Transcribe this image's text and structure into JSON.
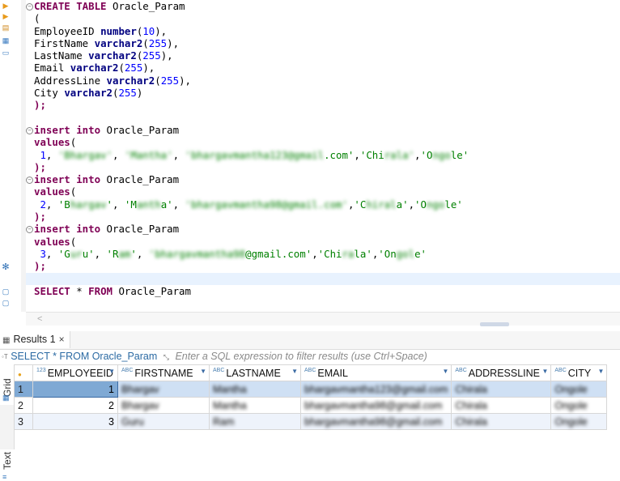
{
  "editor": {
    "lines": [
      {
        "segs": [
          {
            "t": "CREATE TABLE",
            "c": "kw"
          },
          {
            "t": " Oracle_Param",
            "c": ""
          }
        ],
        "fold": true
      },
      {
        "segs": [
          {
            "t": "(",
            "c": ""
          }
        ]
      },
      {
        "segs": [
          {
            "t": "EmployeeID ",
            "c": ""
          },
          {
            "t": "number",
            "c": "ty"
          },
          {
            "t": "(",
            "c": ""
          },
          {
            "t": "10",
            "c": "num"
          },
          {
            "t": "),",
            "c": ""
          }
        ]
      },
      {
        "segs": [
          {
            "t": "FirstName ",
            "c": ""
          },
          {
            "t": "varchar2",
            "c": "ty"
          },
          {
            "t": "(",
            "c": ""
          },
          {
            "t": "255",
            "c": "num"
          },
          {
            "t": "),",
            "c": ""
          }
        ]
      },
      {
        "segs": [
          {
            "t": "LastName ",
            "c": ""
          },
          {
            "t": "varchar2",
            "c": "ty"
          },
          {
            "t": "(",
            "c": ""
          },
          {
            "t": "255",
            "c": "num"
          },
          {
            "t": "),",
            "c": ""
          }
        ]
      },
      {
        "segs": [
          {
            "t": "Email ",
            "c": ""
          },
          {
            "t": "varchar2",
            "c": "ty"
          },
          {
            "t": "(",
            "c": ""
          },
          {
            "t": "255",
            "c": "num"
          },
          {
            "t": "),",
            "c": ""
          }
        ]
      },
      {
        "segs": [
          {
            "t": "AddressLine ",
            "c": ""
          },
          {
            "t": "varchar2",
            "c": "ty"
          },
          {
            "t": "(",
            "c": ""
          },
          {
            "t": "255",
            "c": "num"
          },
          {
            "t": "),",
            "c": ""
          }
        ]
      },
      {
        "segs": [
          {
            "t": "City ",
            "c": ""
          },
          {
            "t": "varchar2",
            "c": "ty"
          },
          {
            "t": "(",
            "c": ""
          },
          {
            "t": "255",
            "c": "num"
          },
          {
            "t": ")",
            "c": ""
          }
        ]
      },
      {
        "segs": [
          {
            "t": ");",
            "c": "kw"
          }
        ]
      },
      {
        "segs": []
      },
      {
        "segs": [
          {
            "t": "insert into",
            "c": "kw"
          },
          {
            "t": " Oracle_Param",
            "c": ""
          }
        ],
        "fold": true
      },
      {
        "segs": [
          {
            "t": "values",
            "c": "kw"
          },
          {
            "t": "(",
            "c": ""
          }
        ]
      },
      {
        "segs": [
          {
            "t": " 1",
            "c": "num"
          },
          {
            "t": ", ",
            "c": ""
          },
          {
            "t": "'Bhargav'",
            "c": "str blur"
          },
          {
            "t": ", ",
            "c": ""
          },
          {
            "t": "'Mantha'",
            "c": "str blur"
          },
          {
            "t": ", ",
            "c": ""
          },
          {
            "t": "'bhargavmantha123@gmail",
            "c": "str blur"
          },
          {
            "t": ".com'",
            "c": "str"
          },
          {
            "t": ",",
            "c": ""
          },
          {
            "t": "'Chi",
            "c": "str"
          },
          {
            "t": "rala'",
            "c": "str blur"
          },
          {
            "t": ",",
            "c": ""
          },
          {
            "t": "'O",
            "c": "str"
          },
          {
            "t": "ngo",
            "c": "str blur"
          },
          {
            "t": "le'",
            "c": "str"
          }
        ]
      },
      {
        "segs": [
          {
            "t": ");",
            "c": "kw"
          }
        ]
      },
      {
        "segs": [
          {
            "t": "insert into",
            "c": "kw"
          },
          {
            "t": " Oracle_Param",
            "c": ""
          }
        ],
        "fold": true
      },
      {
        "segs": [
          {
            "t": "values",
            "c": "kw"
          },
          {
            "t": "(",
            "c": ""
          }
        ]
      },
      {
        "segs": [
          {
            "t": " 2",
            "c": "num"
          },
          {
            "t": ", ",
            "c": ""
          },
          {
            "t": "'B",
            "c": "str"
          },
          {
            "t": "hargav",
            "c": "str blur"
          },
          {
            "t": "'",
            "c": "str"
          },
          {
            "t": ", ",
            "c": ""
          },
          {
            "t": "'M",
            "c": "str"
          },
          {
            "t": "anth",
            "c": "str blur"
          },
          {
            "t": "a'",
            "c": "str"
          },
          {
            "t": ", ",
            "c": ""
          },
          {
            "t": "'bhargavmantha98@gmail.com'",
            "c": "str blur"
          },
          {
            "t": ",",
            "c": ""
          },
          {
            "t": "'C",
            "c": "str"
          },
          {
            "t": "hiral",
            "c": "str blur"
          },
          {
            "t": "a'",
            "c": "str"
          },
          {
            "t": ",",
            "c": ""
          },
          {
            "t": "'O",
            "c": "str"
          },
          {
            "t": "ngo",
            "c": "str blur"
          },
          {
            "t": "le'",
            "c": "str"
          }
        ]
      },
      {
        "segs": [
          {
            "t": ");",
            "c": "kw"
          }
        ]
      },
      {
        "segs": [
          {
            "t": "insert into",
            "c": "kw"
          },
          {
            "t": " Oracle_Param",
            "c": ""
          }
        ],
        "fold": true
      },
      {
        "segs": [
          {
            "t": "values",
            "c": "kw"
          },
          {
            "t": "(",
            "c": ""
          }
        ]
      },
      {
        "segs": [
          {
            "t": " 3",
            "c": "num"
          },
          {
            "t": ", ",
            "c": ""
          },
          {
            "t": "'G",
            "c": "str"
          },
          {
            "t": "ur",
            "c": "str blur"
          },
          {
            "t": "u'",
            "c": "str"
          },
          {
            "t": ", ",
            "c": ""
          },
          {
            "t": "'R",
            "c": "str"
          },
          {
            "t": "am",
            "c": "str blur"
          },
          {
            "t": "'",
            "c": "str"
          },
          {
            "t": ", ",
            "c": ""
          },
          {
            "t": "'bhargavmantha98",
            "c": "str blur"
          },
          {
            "t": "@gmail.com'",
            "c": "str"
          },
          {
            "t": ",",
            "c": ""
          },
          {
            "t": "'Chi",
            "c": "str"
          },
          {
            "t": "ra",
            "c": "str blur"
          },
          {
            "t": "la'",
            "c": "str"
          },
          {
            "t": ",",
            "c": ""
          },
          {
            "t": "'On",
            "c": "str"
          },
          {
            "t": "gol",
            "c": "str blur"
          },
          {
            "t": "e'",
            "c": "str"
          }
        ]
      },
      {
        "segs": [
          {
            "t": ");",
            "c": "kw"
          }
        ]
      },
      {
        "segs": [],
        "active": true
      },
      {
        "segs": [
          {
            "t": "SELECT",
            "c": "kw"
          },
          {
            "t": " * ",
            "c": ""
          },
          {
            "t": "FROM",
            "c": "kw"
          },
          {
            "t": " Oracle_Param",
            "c": ""
          }
        ]
      }
    ]
  },
  "results": {
    "tab_label": "Results 1",
    "close_glyph": "×",
    "query_text": "SELECT * FROM Oracle_Param",
    "filter_placeholder": "Enter a SQL expression to filter results (use Ctrl+Space)",
    "side_tabs": [
      "Grid",
      "Text"
    ],
    "columns": [
      {
        "type": "123",
        "name": "EMPLOYEEID"
      },
      {
        "type": "ABC",
        "name": "FIRSTNAME"
      },
      {
        "type": "ABC",
        "name": "LASTNAME"
      },
      {
        "type": "ABC",
        "name": "EMAIL"
      },
      {
        "type": "ABC",
        "name": "ADDRESSLINE"
      },
      {
        "type": "ABC",
        "name": "CITY"
      }
    ],
    "rows": [
      {
        "n": "1",
        "cells": [
          "1",
          "Bhargav",
          "Mantha",
          "bhargavmantha123@gmail.com",
          "Chirala",
          "Ongole"
        ]
      },
      {
        "n": "2",
        "cells": [
          "2",
          "Bhargav",
          "Mantha",
          "bhargavmantha98@gmail.com",
          "Chirala",
          "Ongole"
        ]
      },
      {
        "n": "3",
        "cells": [
          "3",
          "Guru",
          "Ram",
          "bhargavmantha98@gmail.com",
          "Chirala",
          "Ongole"
        ]
      }
    ]
  }
}
